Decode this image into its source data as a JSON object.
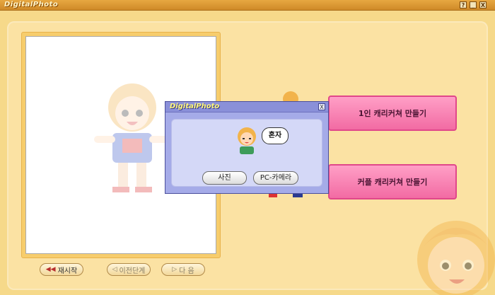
{
  "window": {
    "title": "DigitalPhoto",
    "help_label": "?",
    "minimize_label": "_",
    "close_label": "X"
  },
  "nav": {
    "restart_label": "재시작",
    "prev_label": "이전단계",
    "next_label": "다 음"
  },
  "actions": {
    "solo_label": "1인 캐리커쳐 만들기",
    "couple_label": "커플 캐리커쳐 만들기"
  },
  "dialog": {
    "title": "DigitalPhoto",
    "close_label": "X",
    "speech": "혼자",
    "photo_label": "사진",
    "camera_label": "PC-카메라"
  },
  "colors": {
    "accent_pink": "#f26ba3",
    "dialog_blue": "#a5abe8",
    "window_bg": "#f6d98a"
  },
  "icons": [
    "help-icon",
    "minimize-icon",
    "close-icon",
    "rewind-icon",
    "prev-icon",
    "play-icon"
  ]
}
